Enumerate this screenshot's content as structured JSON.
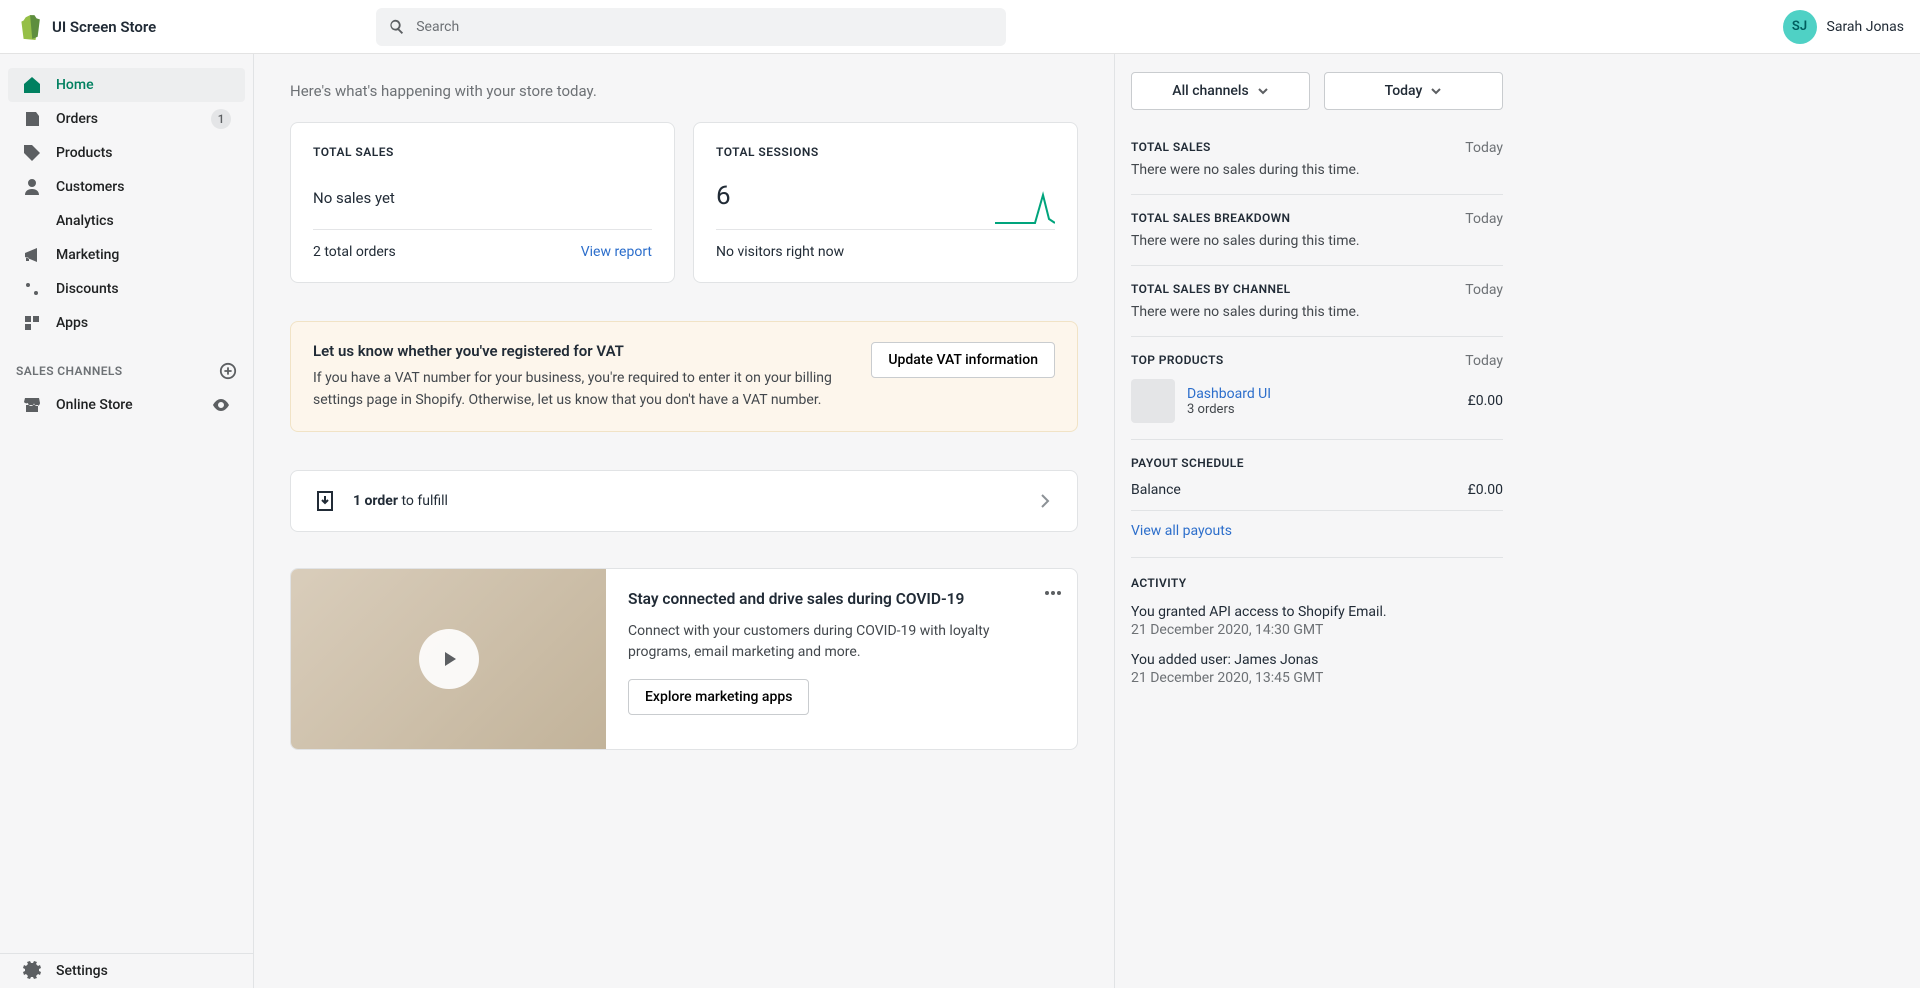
{
  "header": {
    "store_name": "UI Screen Store",
    "search_placeholder": "Search",
    "user_initials": "SJ",
    "user_name": "Sarah Jonas"
  },
  "sidebar": {
    "items": [
      {
        "label": "Home"
      },
      {
        "label": "Orders",
        "badge": "1"
      },
      {
        "label": "Products"
      },
      {
        "label": "Customers"
      },
      {
        "label": "Analytics"
      },
      {
        "label": "Marketing"
      },
      {
        "label": "Discounts"
      },
      {
        "label": "Apps"
      }
    ],
    "channels_header": "SALES CHANNELS",
    "channels": [
      {
        "label": "Online Store"
      }
    ],
    "settings": "Settings"
  },
  "main": {
    "greeting": "Here's what's happening with your store today.",
    "total_sales": {
      "title": "TOTAL SALES",
      "value": "No sales yet",
      "footer_left": "2 total orders",
      "footer_link": "View report"
    },
    "total_sessions": {
      "title": "TOTAL SESSIONS",
      "value": "6",
      "footer_left": "No visitors right now"
    },
    "banner": {
      "title": "Let us know whether you've registered for VAT",
      "body": "If you have a VAT number for your business, you're required to enter it on your billing settings page in Shopify. Otherwise, let us know that you don't have a VAT number.",
      "button": "Update VAT information"
    },
    "task": {
      "count": "1 order",
      "rest": " to fulfill"
    },
    "promo": {
      "title": "Stay connected and drive sales during COVID-19",
      "body": "Connect with your customers during COVID-19 with loyalty programs, email marketing and more.",
      "button": "Explore marketing apps"
    }
  },
  "right": {
    "filter_channels": "All channels",
    "filter_period": "Today",
    "sections": [
      {
        "title": "TOTAL SALES",
        "period": "Today",
        "body": "There were no sales during this time."
      },
      {
        "title": "TOTAL SALES BREAKDOWN",
        "period": "Today",
        "body": "There were no sales during this time."
      },
      {
        "title": "TOTAL SALES BY CHANNEL",
        "period": "Today",
        "body": "There were no sales during this time."
      }
    ],
    "top_products": {
      "title": "TOP PRODUCTS",
      "period": "Today",
      "product_name": "Dashboard UI",
      "product_sub": "3 orders",
      "product_price": "£0.00"
    },
    "payout": {
      "title": "PAYOUT SCHEDULE",
      "balance_label": "Balance",
      "balance_value": "£0.00",
      "link": "View all payouts"
    },
    "activity": {
      "title": "ACTIVITY",
      "items": [
        {
          "text": "You granted API access to Shopify Email.",
          "time": "21 December 2020, 14:30 GMT"
        },
        {
          "text": "You added user: James Jonas",
          "time": "21 December 2020, 13:45 GMT"
        }
      ]
    }
  }
}
